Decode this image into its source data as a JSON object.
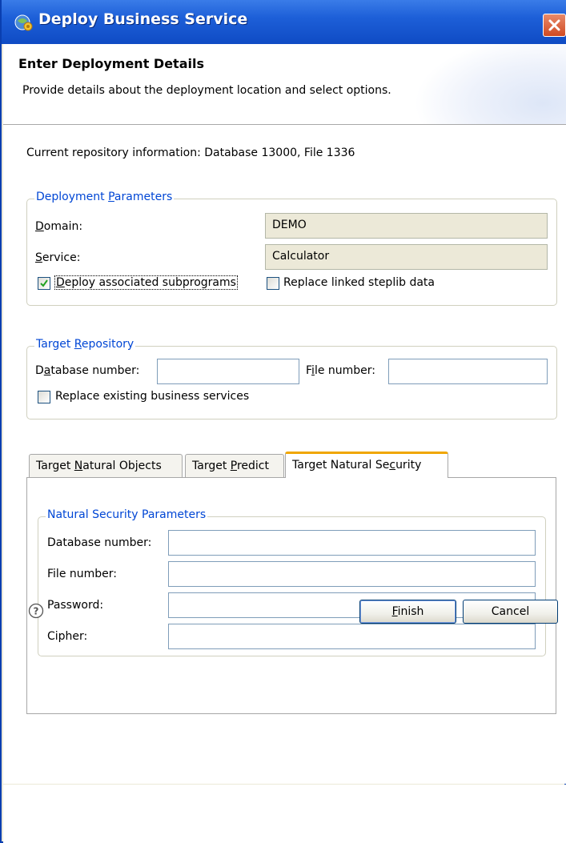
{
  "window": {
    "title": "Deploy Business Service"
  },
  "header": {
    "title": "Enter Deployment Details",
    "description": "Provide details about the deployment location and select options."
  },
  "repo_info": "Current repository information: Database 13000, File 1336",
  "deployment_parameters": {
    "legend_prefix": "Deployment ",
    "legend_underlined": "P",
    "legend_suffix": "arameters",
    "domain_label_underlined": "D",
    "domain_label_rest": "omain:",
    "domain_value": "DEMO",
    "service_label_underlined": "S",
    "service_label_rest": "ervice:",
    "service_value": "Calculator",
    "deploy_subprograms_underlined": "D",
    "deploy_subprograms_rest": "eploy associated subprograms",
    "deploy_subprograms_checked": true,
    "replace_steplib_label": "Replace linked steplib data",
    "replace_steplib_checked": false
  },
  "target_repository": {
    "legend_prefix": "Target ",
    "legend_underlined": "R",
    "legend_suffix": "epository",
    "db_label_pre": "D",
    "db_label_underlined": "a",
    "db_label_rest": "tabase number:",
    "db_value": "",
    "file_label_pre": "F",
    "file_label_underlined": "i",
    "file_label_rest": "le number:",
    "file_value": "",
    "replace_services_label": "Replace existing business services",
    "replace_services_checked": false
  },
  "tabs": [
    {
      "pre": "Target ",
      "underlined": "N",
      "rest": "atural Objects"
    },
    {
      "pre": "Target ",
      "underlined": "P",
      "rest": "redict"
    },
    {
      "pre": "Target Natural Se",
      "underlined": "c",
      "rest": "urity"
    }
  ],
  "active_tab": 2,
  "natural_security": {
    "legend": "Natural Security Parameters",
    "db_label": "Database number:",
    "db_value": "",
    "file_label": "File number:",
    "file_value": "",
    "password_label": "Password:",
    "password_value": "",
    "cipher_label": "Cipher:",
    "cipher_value": ""
  },
  "footer": {
    "help_icon": "question-mark-icon",
    "finish_underlined": "F",
    "finish_rest": "inish",
    "cancel_label": "Cancel"
  },
  "colors": {
    "titlebar": "#1d5fd8",
    "group_legend": "#0046d5",
    "active_tab_accent": "#f0a600"
  }
}
